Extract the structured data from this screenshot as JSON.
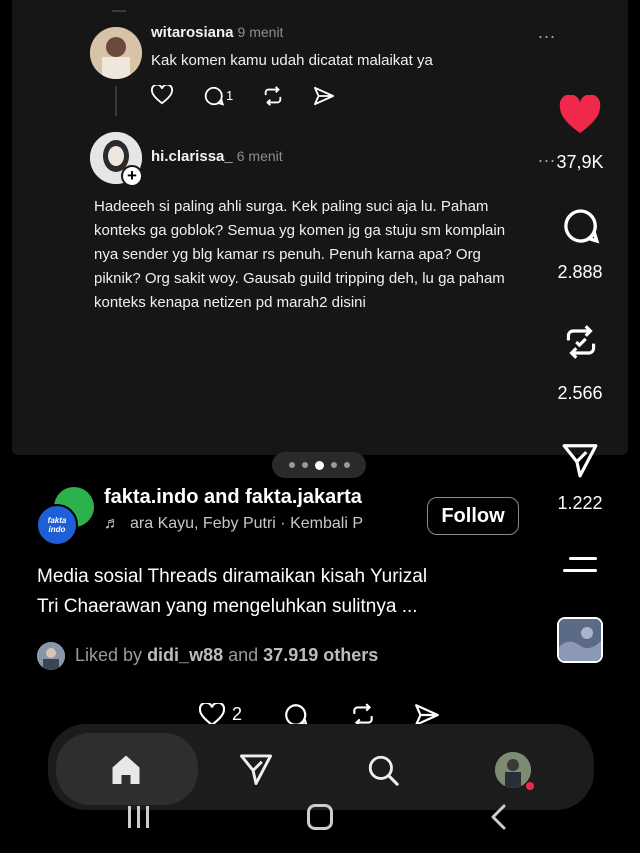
{
  "comments": [
    {
      "username": "witarosiana",
      "time": "9 menit",
      "text": "Kak komen kamu udah dicatat malaikat ya",
      "reply_count": "1",
      "more": "..."
    },
    {
      "username": "hi.clarissa_",
      "time": "6 menit",
      "text_lines": [
        "Hadeeeh si paling ahli surga. Kek paling suci aja lu. Paham",
        "konteks ga goblok? Semua yg komen jg ga stuju sm komplain",
        "nya sender yg blg kamar rs penuh. Penuh karna apa? Org",
        "piknik? Org sakit woy. Gausab guild tripping deh, lu ga paham",
        "konteks kenapa netizen pd marah2 disini"
      ],
      "more": "..."
    }
  ],
  "side_actions": {
    "likes": "37,9K",
    "comments": "2.888",
    "reposts": "2.566",
    "shares": "1.222"
  },
  "carousel": {
    "count": 5,
    "active": 2
  },
  "post": {
    "author_line": "fakta.indo and fakta.jakarta",
    "avatar_text": "fakta indo",
    "audio": "ara Kayu, Feby Putri · Kembali P",
    "follow_label": "Follow",
    "caption_line1": "Media sosial Threads diramaikan kisah Yurizal",
    "caption_line2": "Tri Chaerawan yang mengeluhkan sulitnya ...",
    "liked_prefix": "Liked by",
    "liked_user": "didi_w88",
    "liked_and": "and",
    "liked_others": "37.919 others",
    "small_like_count": "2"
  },
  "colors": {
    "like_red": "#f02849",
    "background": "#000000",
    "panel": "#161616"
  }
}
